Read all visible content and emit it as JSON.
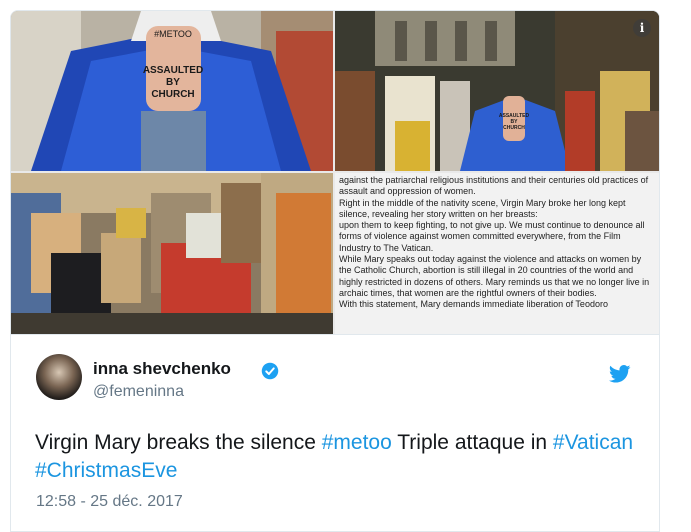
{
  "media": {
    "info_icon": "i",
    "article_text": "against the patriarchal religious institutions and their centuries old practices of assault and oppression of women.\nRight in the middle of the nativity scene, Virgin Mary broke her long kept silence, revealing her story written on her breasts:\nupon them to keep fighting, to not give up. We must continue to denounce all forms of violence against women committed everywhere, from the Film Industry to The Vatican.\nWhile Mary speaks out today against the violence and attacks on women by the Catholic Church, abortion is still illegal in 20 countries of the world and highly restricted in dozens of others. Mary reminds us that we no longer live in archaic times, that women are the rightful owners of their bodies.\nWith this statement, Mary demands immediate liberation of Teodoro",
    "photo1_body_text": "#METOO\nASSAULTED\nBY\nCHURCH",
    "photo2_body_text": "ASSAULTED\nBY\nCHURCH"
  },
  "tweet": {
    "display_name": "inna shevchenko",
    "handle": "@femeninna",
    "text_part1": "Virgin Mary breaks the silence ",
    "hashtag1": "#metoo",
    "text_part2": " Triple attaque in ",
    "hashtag2": "#Vatican",
    "hashtag3": "#ChristmasEve",
    "timestamp": "12:58 - 25 déc. 2017"
  },
  "colors": {
    "link": "#1b95e0",
    "twitter_blue": "#1da1f2",
    "muted": "#657786"
  },
  "icons": [
    "info-icon",
    "verified-badge-icon",
    "twitter-bird-icon"
  ]
}
